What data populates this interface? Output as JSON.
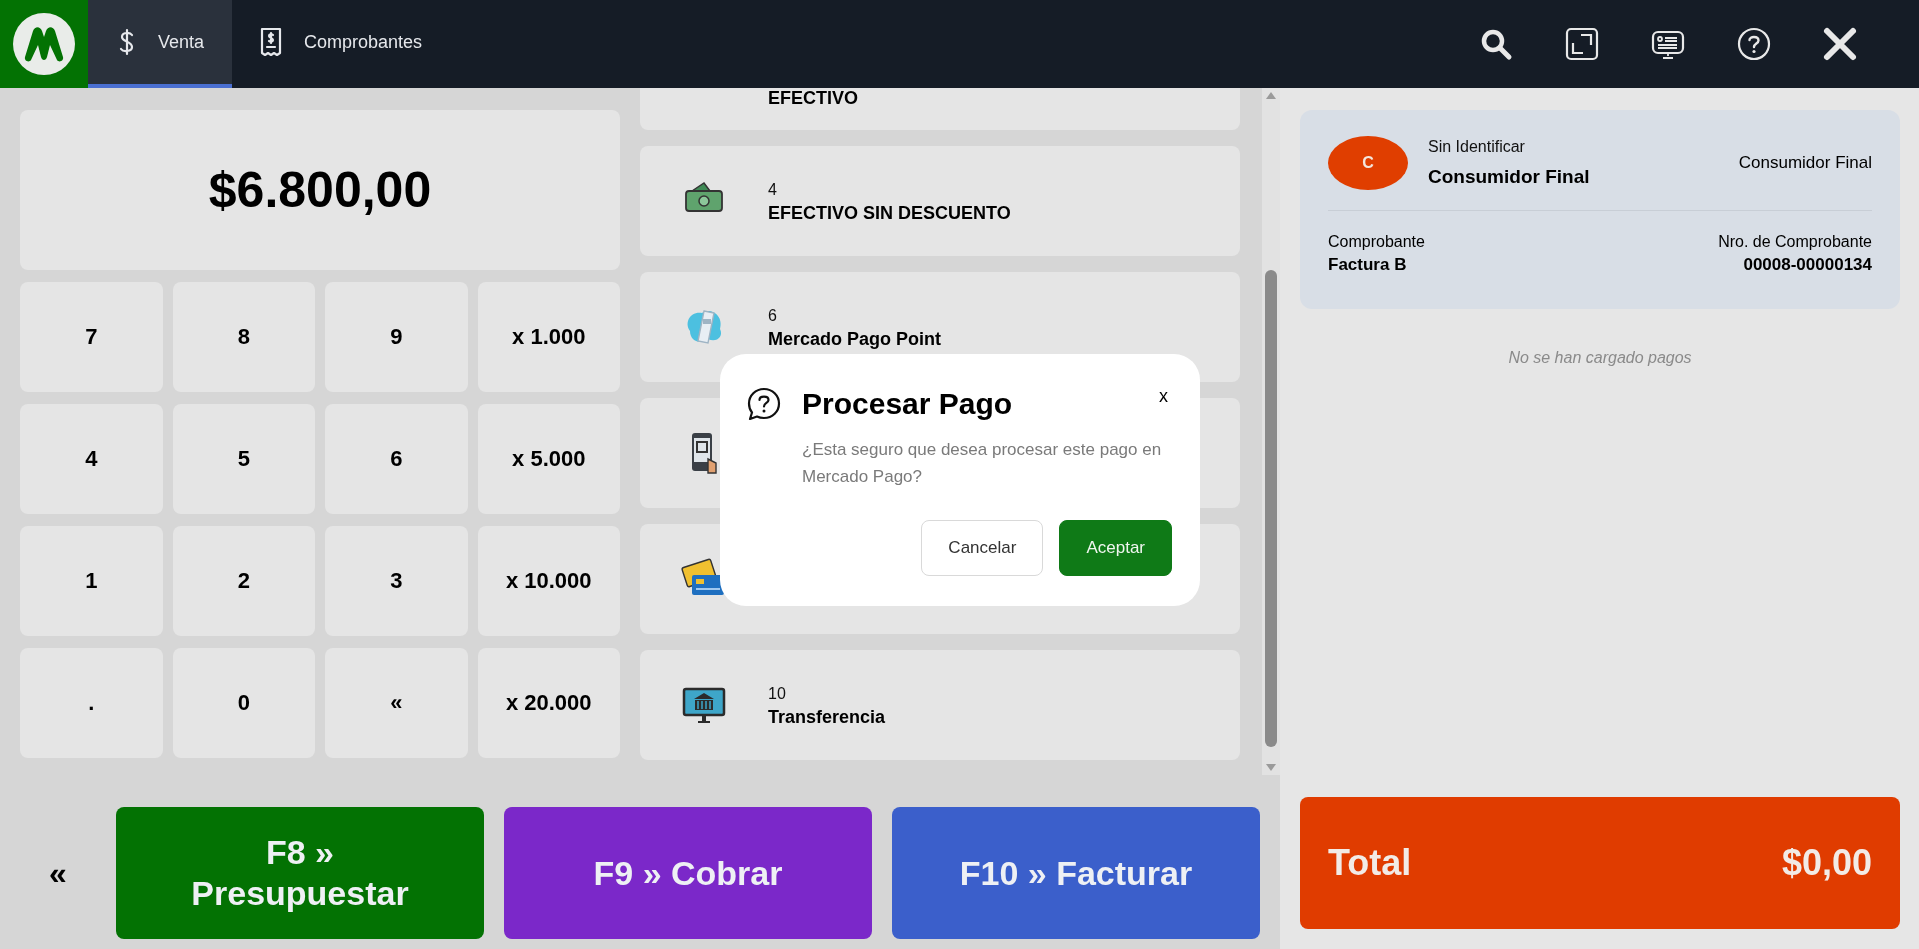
{
  "header": {
    "tabs": [
      {
        "label": "Venta",
        "kind": "dollar",
        "selected": true
      },
      {
        "label": "Comprobantes",
        "kind": "receipt",
        "selected": false
      }
    ],
    "toolbar": [
      {
        "kind": "search"
      },
      {
        "kind": "expand"
      },
      {
        "kind": "display"
      },
      {
        "kind": "help"
      },
      {
        "kind": "close"
      }
    ]
  },
  "amount": "$6.800,00",
  "keypad": [
    "7",
    "8",
    "9",
    "x 1.000",
    "4",
    "5",
    "6",
    "x 5.000",
    "1",
    "2",
    "3",
    "x 10.000",
    ".",
    "0",
    "«",
    "x 20.000"
  ],
  "payment_methods": [
    {
      "name": "EFECTIVO"
    },
    {
      "kind": "cash",
      "number": "4",
      "name": "EFECTIVO SIN DESCUENTO"
    },
    {
      "kind": "pos",
      "number": "6",
      "name": "Mercado Pago Point"
    },
    {
      "kind": "qr"
    },
    {
      "kind": "card"
    },
    {
      "kind": "bank",
      "number": "10",
      "name": "Transferencia"
    }
  ],
  "actions": {
    "back": "«",
    "buttons": [
      {
        "label": "F8 » Presupuestar",
        "color": "#037203"
      },
      {
        "label": "F9 » Cobrar",
        "color": "#7b28c9"
      },
      {
        "label": "F10 » Facturar",
        "color": "#3b5fcb"
      }
    ]
  },
  "customer": {
    "avatar": "C",
    "subtitle": "Sin Identificar",
    "name": "Consumidor Final",
    "type": "Consumidor Final",
    "voucher_label": "Comprobante",
    "voucher": "Factura B",
    "number_label": "Nro. de Comprobante",
    "number": "00008-00000134"
  },
  "payments_empty": "No se han cargado pagos",
  "total": {
    "label": "Total",
    "value": "$0,00"
  },
  "dialog": {
    "title": "Procesar Pago",
    "message": "¿Esta seguro que desea procesar este pago en Mercado Pago?",
    "close": "x",
    "buttons": [
      {
        "label": "Cancelar",
        "kind": "secondary"
      },
      {
        "label": "Aceptar",
        "kind": "primary"
      }
    ]
  }
}
